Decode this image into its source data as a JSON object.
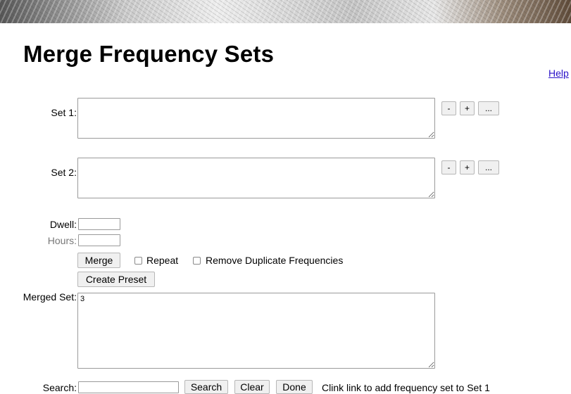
{
  "banner": {
    "icon": "granite-banner-image"
  },
  "page": {
    "title": "Merge Frequency Sets",
    "help_link": "Help"
  },
  "set1": {
    "label": "Set 1:",
    "value": "",
    "minus_label": "-",
    "plus_label": "+",
    "more_label": "..."
  },
  "set2": {
    "label": "Set 2:",
    "value": "",
    "minus_label": "-",
    "plus_label": "+",
    "more_label": "..."
  },
  "dwell": {
    "label": "Dwell:",
    "value": ""
  },
  "hours": {
    "label": "Hours:",
    "value": ""
  },
  "actions": {
    "merge_label": "Merge",
    "repeat_label": "Repeat",
    "repeat_checked": false,
    "remove_dup_label": "Remove Duplicate Frequencies",
    "remove_dup_checked": false,
    "create_preset_label": "Create Preset"
  },
  "merged": {
    "label": "Merged Set:",
    "value": "3"
  },
  "search": {
    "label": "Search:",
    "value": "",
    "search_label": "Search",
    "clear_label": "Clear",
    "done_label": "Done",
    "hint": "Clink link to add frequency set to Set 1"
  },
  "colors": {
    "link": "#2a12c8",
    "muted_label": "#777777"
  }
}
